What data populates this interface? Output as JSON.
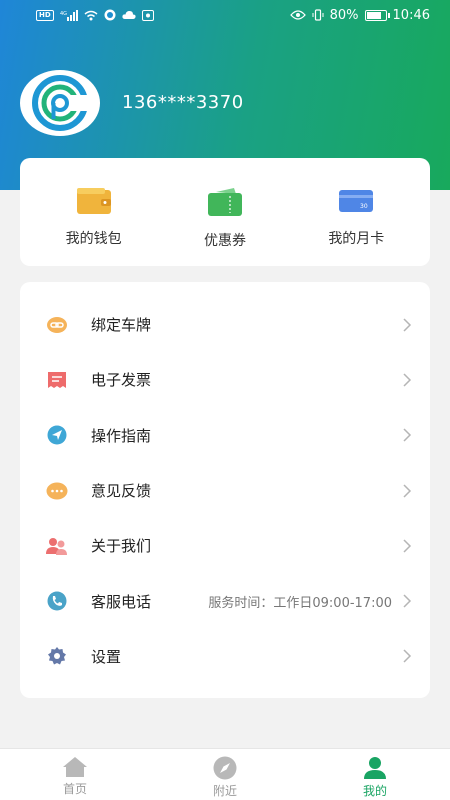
{
  "status_bar": {
    "chip1": "HD",
    "net": "4G",
    "battery_percent": "80%",
    "time": "10:46",
    "battery_level": 0.8
  },
  "profile": {
    "phone": "136****3370"
  },
  "quick_actions": [
    {
      "label": "我的钱包",
      "icon": "wallet-icon"
    },
    {
      "label": "优惠券",
      "icon": "coupon-icon"
    },
    {
      "label": "我的月卡",
      "icon": "monthly-card-icon",
      "badge": "30"
    }
  ],
  "menu": [
    {
      "label": "绑定车牌",
      "icon": "link-icon",
      "value": ""
    },
    {
      "label": "电子发票",
      "icon": "invoice-icon",
      "value": ""
    },
    {
      "label": "操作指南",
      "icon": "navigation-icon",
      "value": ""
    },
    {
      "label": "意见反馈",
      "icon": "chat-icon",
      "value": ""
    },
    {
      "label": "关于我们",
      "icon": "people-icon",
      "value": ""
    },
    {
      "label": "客服电话",
      "icon": "phone-icon",
      "value": "服务时间：工作日09:00-17:00"
    },
    {
      "label": "设置",
      "icon": "gear-icon",
      "value": ""
    }
  ],
  "tabs": [
    {
      "label": "首页",
      "icon": "home-icon",
      "active": false
    },
    {
      "label": "附近",
      "icon": "compass-icon",
      "active": false
    },
    {
      "label": "我的",
      "icon": "user-icon",
      "active": true
    }
  ],
  "colors": {
    "brand_green": "#19a463",
    "header_blue": "#1f86d8"
  }
}
